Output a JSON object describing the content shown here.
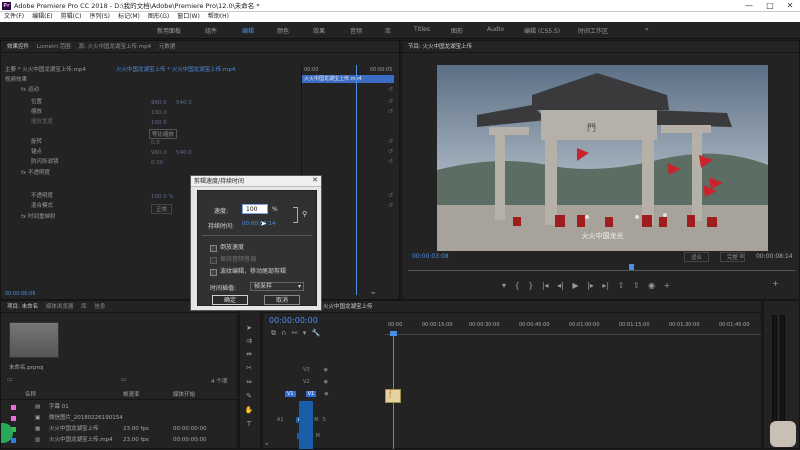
{
  "window": {
    "title": "Adobe Premiere Pro CC 2018 - D:\\我的文档\\Adobe\\Premiere Pro\\12.0\\未命名 *",
    "app_badge": "Pr",
    "minimize": "—",
    "maximize": "□",
    "close": "✕"
  },
  "menu": [
    "文件(F)",
    "编辑(E)",
    "剪辑(C)",
    "序列(S)",
    "标记(M)",
    "图形(G)",
    "窗口(W)",
    "帮助(H)"
  ],
  "workspaces": [
    "新用面板",
    "组件",
    "编辑",
    "颜色",
    "效果",
    "音频",
    "库",
    "Titles",
    "图形",
    "Audio",
    "编辑 (CS5.5)",
    "时间工作区",
    "»"
  ],
  "effect_controls": {
    "tabs": [
      "效果控件",
      "Lumetri 范围",
      "源: 火火中国龙湖宝上传.mp4",
      "元数据"
    ],
    "clip_label": "主要 * 火火中国龙湖宝上传.mp4",
    "seq_label": "火火中国龙湖宝上传 * 火火中国龙湖宝上传.mp4",
    "timecode_start": "00:00",
    "timecode_end": "00:00:05",
    "clip_name": "火火中国龙湖宝上传.mp4",
    "section": "视频效果",
    "rows": [
      {
        "label": "fx 运动",
        "value": "",
        "value2": ""
      },
      {
        "label": "位置",
        "value": "960.0",
        "value2": "540.0"
      },
      {
        "label": "缩放",
        "value": "100.0",
        "value2": ""
      },
      {
        "label": "缩放宽度",
        "value": "100.0",
        "value2": ""
      },
      {
        "label": "",
        "value": "等比缩放",
        "value2": ""
      },
      {
        "label": "旋转",
        "value": "0.0",
        "value2": ""
      },
      {
        "label": "锚点",
        "value": "960.0",
        "value2": "540.0"
      },
      {
        "label": "防闪烁滤镜",
        "value": "0.00",
        "value2": ""
      },
      {
        "label": "fx 不透明度",
        "value": "",
        "value2": ""
      },
      {
        "label": "不透明度",
        "value": "100.0 %",
        "value2": ""
      },
      {
        "label": "混合模式",
        "value": "正常",
        "value2": ""
      },
      {
        "label": "fx 时间重映射",
        "value": "",
        "value2": ""
      }
    ],
    "footer_timecode": "00:00:06:06"
  },
  "program": {
    "tab": "节目: 火火中国龙湖宝上传",
    "video_caption": "火火中国龙光",
    "timecode": "00:00:03:08",
    "fit": "适合",
    "quality": "完整",
    "duration": "00:00:08:14"
  },
  "dialog": {
    "title": "剪辑速度/持续时间",
    "speed_label": "速度:",
    "speed_value": "100",
    "percent": "%",
    "duration_label": "持续时间:",
    "duration_value": "00:00:08:14",
    "options": [
      "倒放速度",
      "保持音频音调",
      "波纹编辑，移动尾部剪辑"
    ],
    "checked": [
      false,
      false,
      false
    ],
    "interp_label": "时间插值:",
    "interp_value": "帧采样",
    "ok": "确定",
    "cancel": "取消"
  },
  "project": {
    "tabs": [
      "项目: 未命名",
      "媒体浏览器",
      "库",
      "信息"
    ],
    "name": "未命名.prproj",
    "count": "4 个项",
    "headers": [
      "名称",
      "帧速率",
      "媒体开始"
    ],
    "items": [
      {
        "name": "字幕 01",
        "fps": "",
        "start": "",
        "color": "#e86fd6"
      },
      {
        "name": "微信图片_20180226190154",
        "fps": "",
        "start": "",
        "color": "#e86fd6"
      },
      {
        "name": "火火中国龙湖宝上传",
        "fps": "23.00 fps",
        "start": "00:00:00:00",
        "color": "#3dba4e"
      },
      {
        "name": "火火中国龙湖宝上传.mp4",
        "fps": "23.00 fps",
        "start": "00:00:00:00",
        "color": "#2b7de0"
      }
    ]
  },
  "timeline": {
    "tab": "火火中国龙湖宝上传",
    "timecode": "00:00:00:00",
    "ruler": [
      "00:00",
      "00:00:15:00",
      "00:00:30:00",
      "00:00:45:00",
      "00:01:00:00",
      "00:01:15:00",
      "00:01:30:00",
      "00:01:45:00"
    ],
    "tracks": [
      "V3",
      "V2",
      "V1",
      "A1",
      "A2"
    ]
  },
  "colors": {
    "accent": "#4d8ee5",
    "clip_selected": "#2f6fd6",
    "clip_audio": "#1a5da8"
  }
}
